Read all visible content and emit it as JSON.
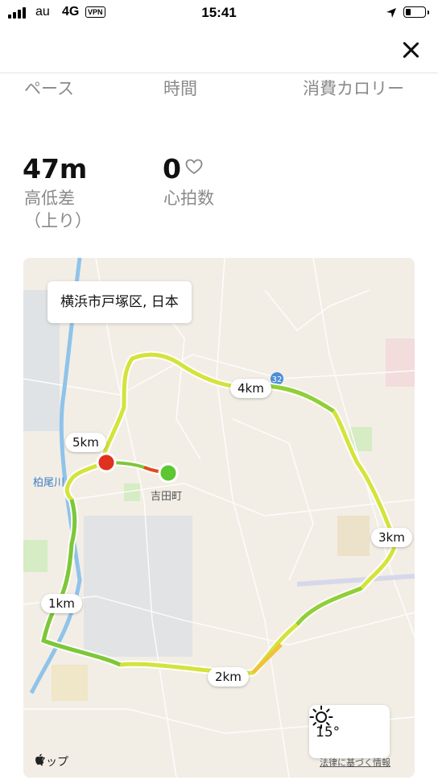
{
  "status_bar": {
    "carrier": "au",
    "network": "4G",
    "vpn": "VPN",
    "time": "15:41"
  },
  "header": {
    "close_icon": "close-icon"
  },
  "metrics": [
    {
      "label": "ペース",
      "value": ""
    },
    {
      "label": "時間",
      "value": ""
    },
    {
      "label": "消費カロリー",
      "value": ""
    },
    {
      "label": "高低差\n（上り）",
      "value": "47m"
    },
    {
      "label": "心拍数",
      "value": "0"
    }
  ],
  "map": {
    "location": "横浜市戸塚区, 日本",
    "km_markers": [
      "1km",
      "2km",
      "3km",
      "4km",
      "5km"
    ],
    "place_label": "吉田町",
    "river_label": "柏尾川",
    "route_shield": "32",
    "start_color": "#5cc730",
    "end_color": "#e0301e",
    "weather": {
      "temperature": "15°",
      "icon": "sun-icon"
    },
    "brand": "マップ",
    "legal": "法律に基づく情報"
  }
}
